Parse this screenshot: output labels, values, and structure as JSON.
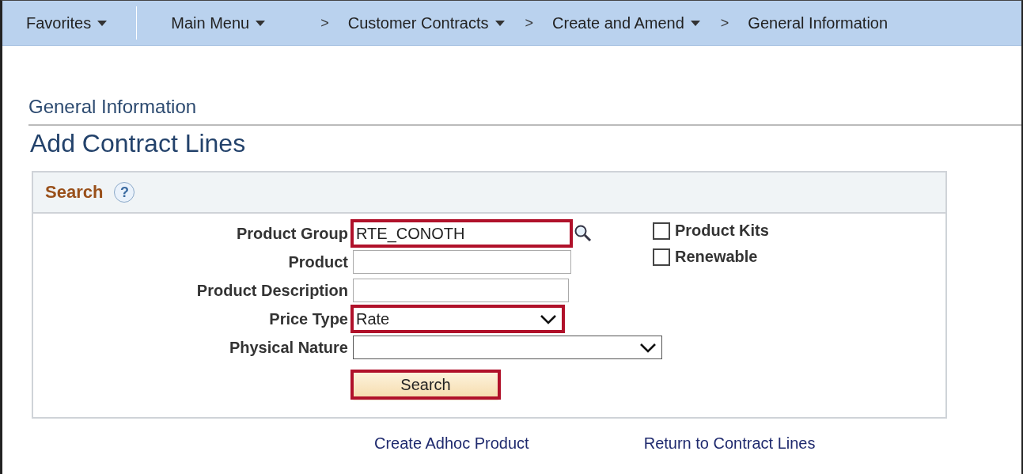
{
  "nav": {
    "items": [
      {
        "label": "Favorites",
        "kind": "menu"
      },
      {
        "label": "Main Menu",
        "kind": "menu"
      },
      {
        "label": "Customer Contracts",
        "kind": "menu"
      },
      {
        "label": "Create and Amend",
        "kind": "menu"
      },
      {
        "label": "General Information",
        "kind": "page"
      }
    ],
    "separator": ">"
  },
  "page": {
    "subtitle": "General Information",
    "title": "Add Contract Lines"
  },
  "search": {
    "header": "Search",
    "help": "?",
    "fields": [
      {
        "label": "Product Group",
        "kind": "text",
        "value": "RTE_CONOTH",
        "highlighted": true,
        "lookup": true
      },
      {
        "label": "Product",
        "kind": "text",
        "highlighted": false
      },
      {
        "label": "Product Description",
        "kind": "text",
        "highlighted": false
      },
      {
        "label": "Price Type",
        "kind": "select",
        "value": "Rate",
        "highlighted": true
      },
      {
        "label": "Physical Nature",
        "kind": "select",
        "highlighted": false
      }
    ],
    "checkboxes": [
      {
        "label": "Product Kits",
        "checked": false
      },
      {
        "label": "Renewable",
        "checked": false
      }
    ],
    "button": {
      "label": "Search",
      "highlighted": true
    }
  },
  "links": [
    "Create Adhoc Product",
    "Return to Contract Lines"
  ]
}
